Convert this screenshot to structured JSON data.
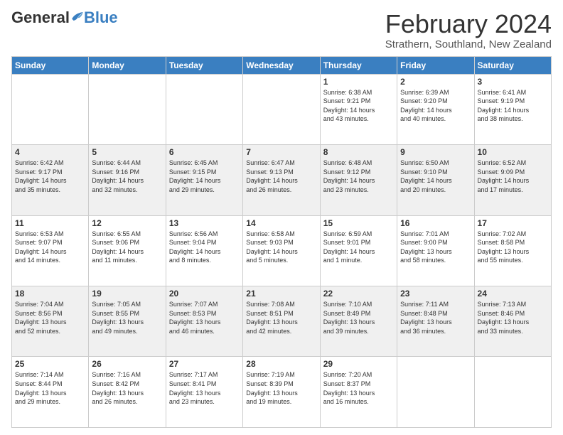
{
  "header": {
    "logo_general": "General",
    "logo_blue": "Blue",
    "month_title": "February 2024",
    "location": "Strathern, Southland, New Zealand"
  },
  "columns": [
    "Sunday",
    "Monday",
    "Tuesday",
    "Wednesday",
    "Thursday",
    "Friday",
    "Saturday"
  ],
  "weeks": [
    [
      {
        "day": "",
        "info": ""
      },
      {
        "day": "",
        "info": ""
      },
      {
        "day": "",
        "info": ""
      },
      {
        "day": "",
        "info": ""
      },
      {
        "day": "1",
        "info": "Sunrise: 6:38 AM\nSunset: 9:21 PM\nDaylight: 14 hours\nand 43 minutes."
      },
      {
        "day": "2",
        "info": "Sunrise: 6:39 AM\nSunset: 9:20 PM\nDaylight: 14 hours\nand 40 minutes."
      },
      {
        "day": "3",
        "info": "Sunrise: 6:41 AM\nSunset: 9:19 PM\nDaylight: 14 hours\nand 38 minutes."
      }
    ],
    [
      {
        "day": "4",
        "info": "Sunrise: 6:42 AM\nSunset: 9:17 PM\nDaylight: 14 hours\nand 35 minutes."
      },
      {
        "day": "5",
        "info": "Sunrise: 6:44 AM\nSunset: 9:16 PM\nDaylight: 14 hours\nand 32 minutes."
      },
      {
        "day": "6",
        "info": "Sunrise: 6:45 AM\nSunset: 9:15 PM\nDaylight: 14 hours\nand 29 minutes."
      },
      {
        "day": "7",
        "info": "Sunrise: 6:47 AM\nSunset: 9:13 PM\nDaylight: 14 hours\nand 26 minutes."
      },
      {
        "day": "8",
        "info": "Sunrise: 6:48 AM\nSunset: 9:12 PM\nDaylight: 14 hours\nand 23 minutes."
      },
      {
        "day": "9",
        "info": "Sunrise: 6:50 AM\nSunset: 9:10 PM\nDaylight: 14 hours\nand 20 minutes."
      },
      {
        "day": "10",
        "info": "Sunrise: 6:52 AM\nSunset: 9:09 PM\nDaylight: 14 hours\nand 17 minutes."
      }
    ],
    [
      {
        "day": "11",
        "info": "Sunrise: 6:53 AM\nSunset: 9:07 PM\nDaylight: 14 hours\nand 14 minutes."
      },
      {
        "day": "12",
        "info": "Sunrise: 6:55 AM\nSunset: 9:06 PM\nDaylight: 14 hours\nand 11 minutes."
      },
      {
        "day": "13",
        "info": "Sunrise: 6:56 AM\nSunset: 9:04 PM\nDaylight: 14 hours\nand 8 minutes."
      },
      {
        "day": "14",
        "info": "Sunrise: 6:58 AM\nSunset: 9:03 PM\nDaylight: 14 hours\nand 5 minutes."
      },
      {
        "day": "15",
        "info": "Sunrise: 6:59 AM\nSunset: 9:01 PM\nDaylight: 14 hours\nand 1 minute."
      },
      {
        "day": "16",
        "info": "Sunrise: 7:01 AM\nSunset: 9:00 PM\nDaylight: 13 hours\nand 58 minutes."
      },
      {
        "day": "17",
        "info": "Sunrise: 7:02 AM\nSunset: 8:58 PM\nDaylight: 13 hours\nand 55 minutes."
      }
    ],
    [
      {
        "day": "18",
        "info": "Sunrise: 7:04 AM\nSunset: 8:56 PM\nDaylight: 13 hours\nand 52 minutes."
      },
      {
        "day": "19",
        "info": "Sunrise: 7:05 AM\nSunset: 8:55 PM\nDaylight: 13 hours\nand 49 minutes."
      },
      {
        "day": "20",
        "info": "Sunrise: 7:07 AM\nSunset: 8:53 PM\nDaylight: 13 hours\nand 46 minutes."
      },
      {
        "day": "21",
        "info": "Sunrise: 7:08 AM\nSunset: 8:51 PM\nDaylight: 13 hours\nand 42 minutes."
      },
      {
        "day": "22",
        "info": "Sunrise: 7:10 AM\nSunset: 8:49 PM\nDaylight: 13 hours\nand 39 minutes."
      },
      {
        "day": "23",
        "info": "Sunrise: 7:11 AM\nSunset: 8:48 PM\nDaylight: 13 hours\nand 36 minutes."
      },
      {
        "day": "24",
        "info": "Sunrise: 7:13 AM\nSunset: 8:46 PM\nDaylight: 13 hours\nand 33 minutes."
      }
    ],
    [
      {
        "day": "25",
        "info": "Sunrise: 7:14 AM\nSunset: 8:44 PM\nDaylight: 13 hours\nand 29 minutes."
      },
      {
        "day": "26",
        "info": "Sunrise: 7:16 AM\nSunset: 8:42 PM\nDaylight: 13 hours\nand 26 minutes."
      },
      {
        "day": "27",
        "info": "Sunrise: 7:17 AM\nSunset: 8:41 PM\nDaylight: 13 hours\nand 23 minutes."
      },
      {
        "day": "28",
        "info": "Sunrise: 7:19 AM\nSunset: 8:39 PM\nDaylight: 13 hours\nand 19 minutes."
      },
      {
        "day": "29",
        "info": "Sunrise: 7:20 AM\nSunset: 8:37 PM\nDaylight: 13 hours\nand 16 minutes."
      },
      {
        "day": "",
        "info": ""
      },
      {
        "day": "",
        "info": ""
      }
    ]
  ]
}
